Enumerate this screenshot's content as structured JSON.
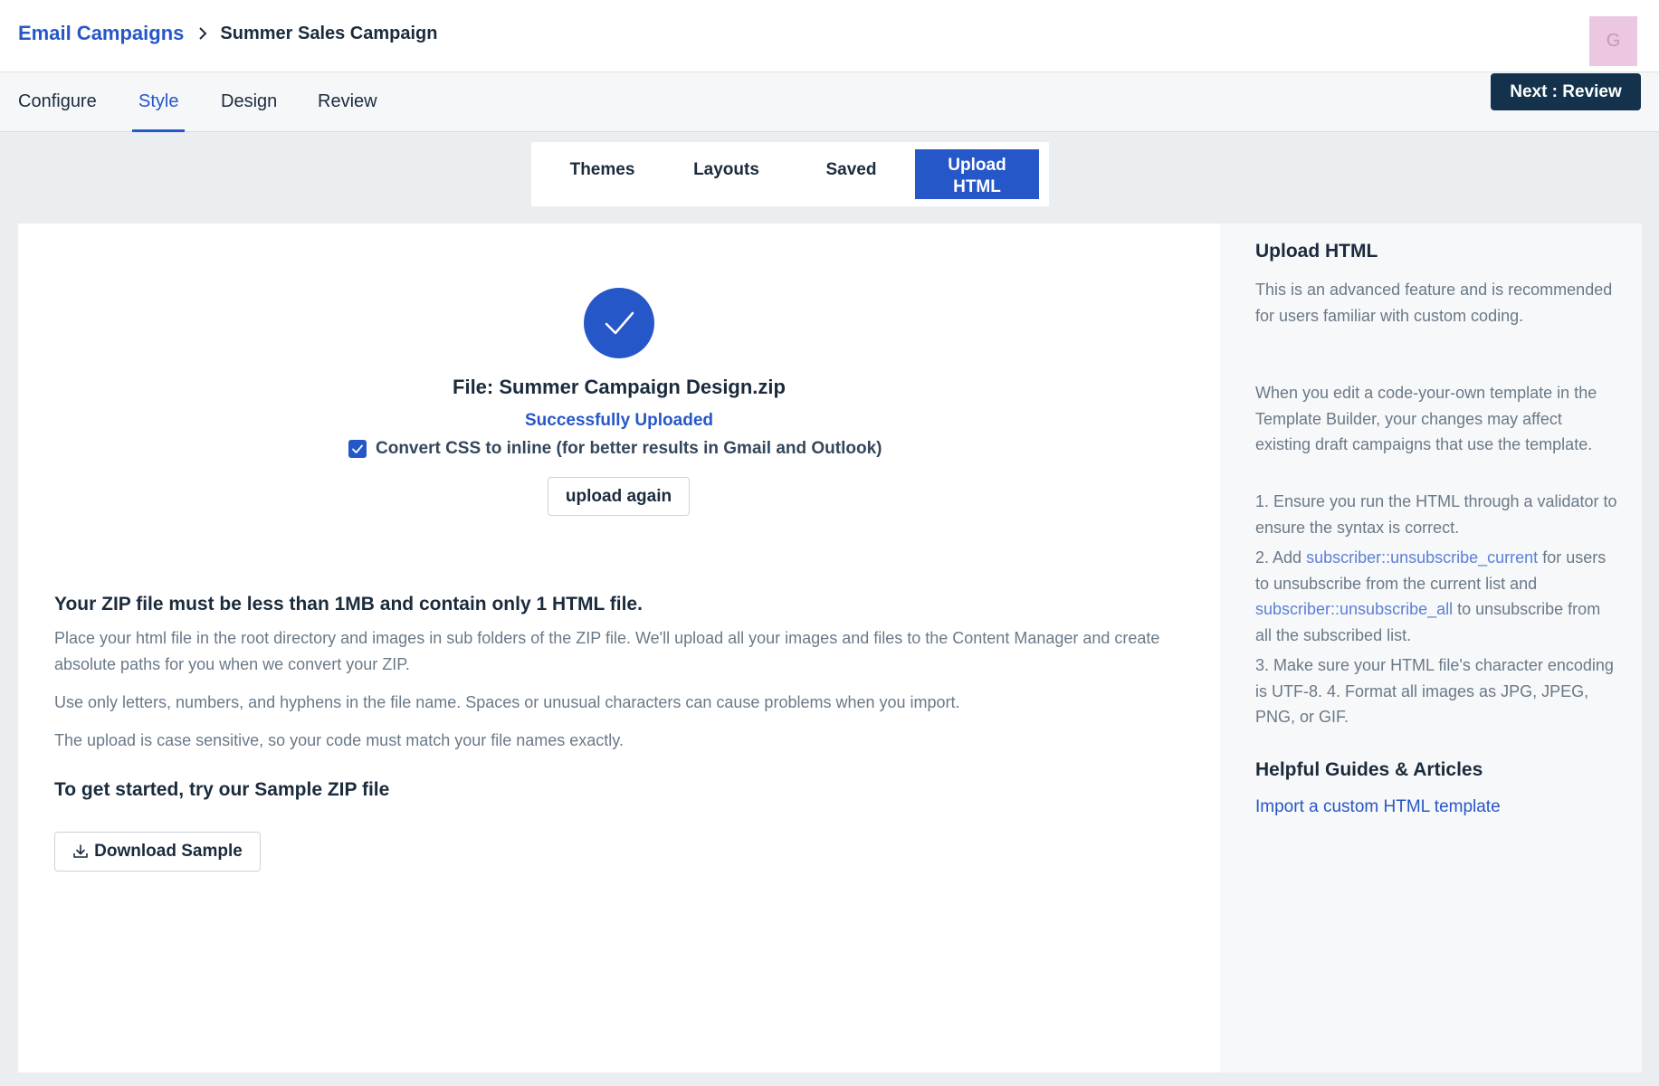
{
  "breadcrumb": {
    "parent": "Email Campaigns",
    "current": "Summer Sales Campaign"
  },
  "avatar": {
    "initial": "G"
  },
  "nav": {
    "tabs": [
      {
        "label": "Configure",
        "active": false
      },
      {
        "label": "Style",
        "active": true
      },
      {
        "label": "Design",
        "active": false
      },
      {
        "label": "Review",
        "active": false
      }
    ],
    "next_label": "Next : Review"
  },
  "style_tabs": [
    {
      "label": "Themes",
      "active": false
    },
    {
      "label": "Layouts",
      "active": false
    },
    {
      "label": "Saved",
      "active": false
    },
    {
      "label": "Upload HTML",
      "active": true
    }
  ],
  "upload": {
    "file_label": "File: Summer Campaign Design.zip",
    "status": "Successfully Uploaded",
    "convert_css_label": "Convert CSS to inline (for better results in Gmail and Outlook)",
    "convert_css_checked": true,
    "upload_again_label": "upload again"
  },
  "requirements": {
    "title": "Your ZIP file must be less than 1MB and contain only 1 HTML file.",
    "p1": "Place your html file in the root directory and images in sub folders of the ZIP file. We'll upload all your images and files to the Content Manager and create absolute paths for you when we convert your ZIP.",
    "p2": "Use only letters, numbers, and hyphens in the file name. Spaces or unusual characters can cause problems when you import.",
    "p3": "The upload is case sensitive, so your code must match your file names exactly."
  },
  "sample": {
    "title": "To get started, try our Sample ZIP file",
    "download_label": "Download Sample"
  },
  "sidebar": {
    "title": "Upload HTML",
    "intro": "This is an advanced feature and is recommended for users familiar with custom coding.",
    "edit_note": "When you edit a code-your-own template in the Template Builder, your changes may affect existing draft campaigns that use the template.",
    "step1": "1. Ensure you run the HTML through a validator to ensure the syntax is correct.",
    "step2_a": "2. Add ",
    "step2_code1": "subscriber::unsubscribe_current",
    "step2_b": " for users to unsubscribe from the current list and ",
    "step2_code2": "subscriber::unsubscribe_all",
    "step2_c": " to unsubscribe from all the subscribed list.",
    "step3": "3. Make sure your HTML file's character encoding is UTF-8. 4. Format all images as JPG, JPEG, PNG, or GIF.",
    "guides_title": "Helpful Guides & Articles",
    "guide_link": "Import a custom HTML template"
  },
  "colors": {
    "accent": "#2657c8",
    "dark_button": "#14324c",
    "avatar_bg": "#ecc7e2"
  }
}
